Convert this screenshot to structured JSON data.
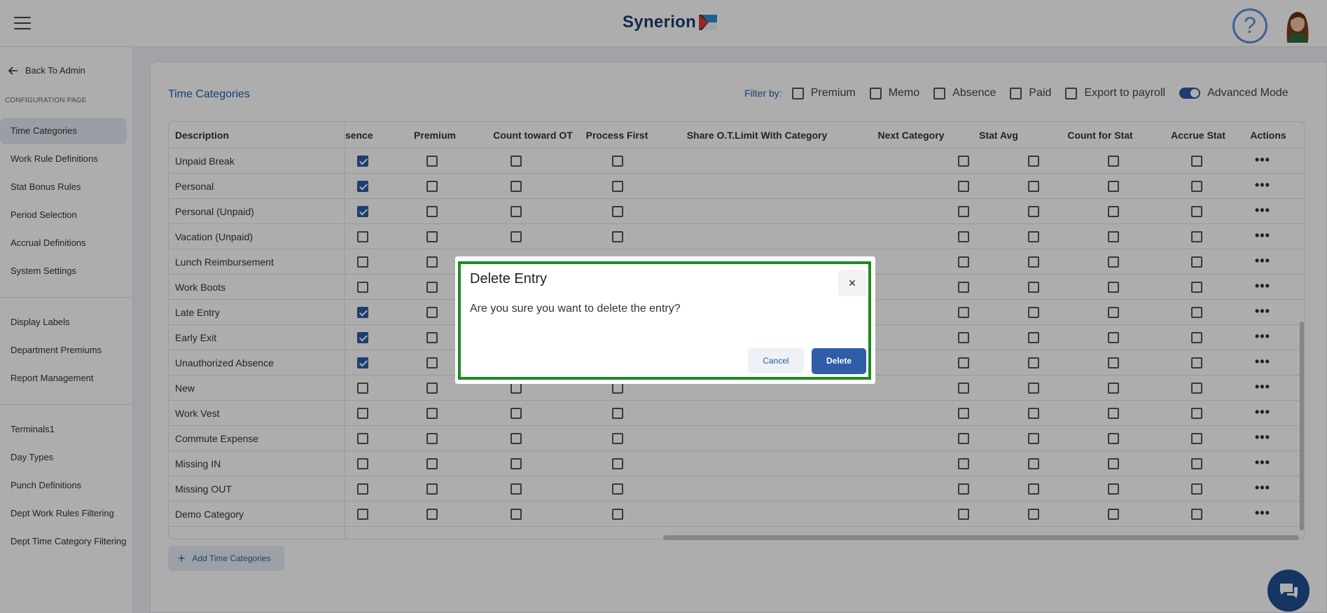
{
  "header": {
    "logo_text": "Synerion",
    "help_symbol": "?",
    "menu_icon": "hamburger-icon",
    "avatar_icon": "user-avatar"
  },
  "sidebar": {
    "back_label": "Back To Admin",
    "section_label": "CONFIGURATION PAGE",
    "group1": [
      {
        "label": "Time Categories",
        "active": true
      },
      {
        "label": "Work Rule Definitions"
      },
      {
        "label": "Stat Bonus Rules"
      },
      {
        "label": "Period Selection"
      },
      {
        "label": "Accrual Definitions"
      },
      {
        "label": "System Settings"
      }
    ],
    "group2": [
      {
        "label": "Display Labels"
      },
      {
        "label": "Department Premiums"
      },
      {
        "label": "Report Management"
      }
    ],
    "group3": [
      {
        "label": "Terminals1"
      },
      {
        "label": "Day Types"
      },
      {
        "label": "Punch Definitions"
      },
      {
        "label": "Dept Work Rules Filtering"
      },
      {
        "label": "Dept Time Category Filtering"
      }
    ]
  },
  "main": {
    "title": "Time Categories",
    "filter_label": "Filter by:",
    "filters": [
      "Premium",
      "Memo",
      "Absence",
      "Paid",
      "Export to payroll"
    ],
    "advanced_mode_label": "Advanced Mode",
    "advanced_mode_on": true,
    "add_button_label": "Add Time Categories"
  },
  "table": {
    "columns": [
      "Description",
      "sence",
      "Premium",
      "Count toward OT",
      "Process First",
      "Share O.T.Limit With Category",
      "Next Category",
      "Stat Avg",
      "Count for Stat",
      "Accrue Stat",
      "Actions"
    ],
    "rows": [
      {
        "description": "Unpaid Break",
        "absence": true
      },
      {
        "description": "Personal",
        "absence": true
      },
      {
        "description": "Personal (Unpaid)",
        "absence": true
      },
      {
        "description": "Vacation (Unpaid)",
        "absence": false
      },
      {
        "description": "Lunch Reimbursement",
        "absence": false
      },
      {
        "description": "Work Boots",
        "absence": false
      },
      {
        "description": "Late Entry",
        "absence": true
      },
      {
        "description": "Early Exit",
        "absence": true
      },
      {
        "description": "Unauthorized Absence",
        "absence": true
      },
      {
        "description": "New",
        "absence": false
      },
      {
        "description": "Work Vest",
        "absence": false
      },
      {
        "description": "Commute Expense",
        "absence": false
      },
      {
        "description": "Missing IN",
        "absence": false
      },
      {
        "description": "Missing OUT",
        "absence": false
      },
      {
        "description": "Demo Category",
        "absence": false
      }
    ],
    "actions_symbol": "•••"
  },
  "dialog": {
    "title": "Delete Entry",
    "message": "Are you sure you want to delete the entry?",
    "close_symbol": "×",
    "cancel_label": "Cancel",
    "delete_label": "Delete"
  }
}
